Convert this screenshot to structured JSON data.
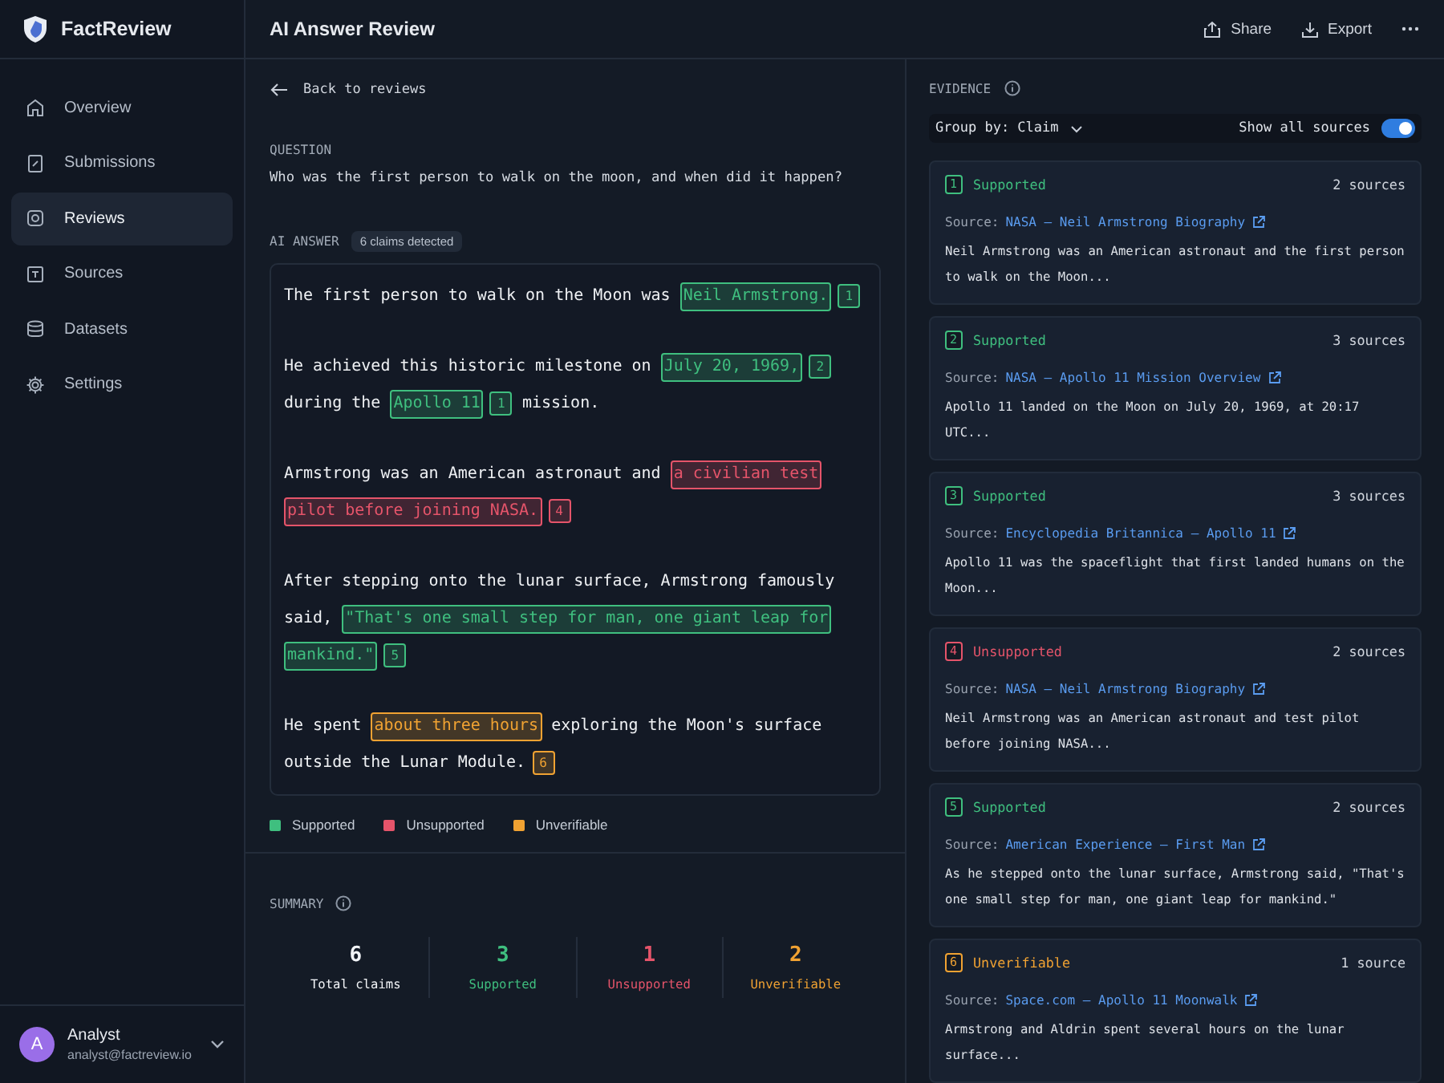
{
  "app": {
    "name": "FactReview"
  },
  "sidebar": {
    "items": [
      {
        "label": "Overview",
        "selected": false
      },
      {
        "label": "Submissions",
        "selected": false
      },
      {
        "label": "Reviews",
        "selected": true
      },
      {
        "label": "Sources",
        "selected": false
      },
      {
        "label": "Datasets",
        "selected": false
      },
      {
        "label": "Settings",
        "selected": false
      }
    ],
    "user": {
      "initial": "A",
      "name": "Analyst",
      "email": "analyst@factreview.io"
    }
  },
  "header": {
    "title": "AI Answer Review",
    "actions": [
      {
        "label": "Share"
      },
      {
        "label": "Export"
      }
    ]
  },
  "back_link": "Back to reviews",
  "question": {
    "label": "QUESTION",
    "text": "Who was the first person to walk on the moon, and when did it happen?"
  },
  "answer": {
    "label": "AI ANSWER",
    "badge": "6 claims detected",
    "paragraphs": [
      {
        "lines": [
          {
            "segments": [
              {
                "kind": "text",
                "text": "The first person to walk on the Moon was "
              },
              {
                "kind": "claim",
                "text": "Neil Armstrong.",
                "color": "#3fbf7f",
                "num": "1"
              }
            ]
          }
        ]
      },
      {
        "lines": [
          {
            "segments": [
              {
                "kind": "text",
                "text": "He achieved this historic milestone on "
              },
              {
                "kind": "claim",
                "text": "July 20, 1969,",
                "color": "#3fbf7f",
                "num": "2"
              }
            ]
          },
          {
            "segments": [
              {
                "kind": "text",
                "text": "during the "
              },
              {
                "kind": "claim",
                "text": "Apollo 11",
                "color": "#3fbf7f",
                "num": "1"
              },
              {
                "kind": "text",
                "text": " mission."
              }
            ]
          }
        ]
      },
      {
        "lines": [
          {
            "segments": [
              {
                "kind": "text",
                "text": "Armstrong was an American astronaut and "
              },
              {
                "kind": "claim",
                "text": "a civilian test",
                "color": "#e5546a"
              }
            ]
          },
          {
            "segments": [
              {
                "kind": "claim",
                "text": "pilot before joining NASA.",
                "color": "#e5546a",
                "num": "4"
              }
            ]
          }
        ]
      },
      {
        "lines": [
          {
            "segments": [
              {
                "kind": "text",
                "text": "After stepping onto the lunar surface, Armstrong famously"
              }
            ]
          },
          {
            "segments": [
              {
                "kind": "text",
                "text": "said, "
              },
              {
                "kind": "claim",
                "text": "\"That's one small step for man, one giant leap for",
                "color": "#3fbf7f"
              }
            ]
          },
          {
            "segments": [
              {
                "kind": "claim",
                "text": "mankind.\"",
                "color": "#3fbf7f",
                "num": "5"
              }
            ]
          }
        ]
      },
      {
        "lines": [
          {
            "segments": [
              {
                "kind": "text",
                "text": "He spent "
              },
              {
                "kind": "claim",
                "text": "about three hours",
                "color": "#f0a232"
              },
              {
                "kind": "text",
                "text": " exploring the Moon's surface"
              }
            ]
          },
          {
            "segments": [
              {
                "kind": "text",
                "text": "outside the Lunar Module."
              },
              {
                "kind": "badge",
                "color": "#f0a232",
                "num": "6"
              }
            ]
          }
        ]
      }
    ]
  },
  "legend": [
    {
      "label": "Supported",
      "color": "#3fbf7f"
    },
    {
      "label": "Unsupported",
      "color": "#e5546a"
    },
    {
      "label": "Unverifiable",
      "color": "#f0a232"
    }
  ],
  "summary": {
    "label": "SUMMARY",
    "stats": [
      {
        "value": "6",
        "label": "Total claims",
        "color": "#f2f4f7"
      },
      {
        "value": "3",
        "label": "Supported",
        "color": "#3fbf7f"
      },
      {
        "value": "1",
        "label": "Unsupported",
        "color": "#e5546a"
      },
      {
        "value": "2",
        "label": "Unverifiable",
        "color": "#f0a232"
      }
    ]
  },
  "evidence": {
    "label": "EVIDENCE",
    "group_by": "Group by: Claim",
    "show_all_label": "Show all sources",
    "show_all_on": true,
    "cards": [
      {
        "num": "1",
        "color": "#3fbf7f",
        "status_label": "Supported",
        "count": "2 sources",
        "source_prefix": "Source:",
        "source": "NASA – Neil Armstrong Biography",
        "excerpt": "Neil Armstrong was an American astronaut and the first person to walk on the Moon..."
      },
      {
        "num": "2",
        "color": "#3fbf7f",
        "status_label": "Supported",
        "count": "3 sources",
        "source_prefix": "Source:",
        "source": "NASA – Apollo 11 Mission Overview",
        "excerpt": "Apollo 11 landed on the Moon on July 20, 1969, at 20:17 UTC..."
      },
      {
        "num": "3",
        "color": "#3fbf7f",
        "status_label": "Supported",
        "count": "3 sources",
        "source_prefix": "Source:",
        "source": "Encyclopedia Britannica – Apollo 11",
        "excerpt": "Apollo 11 was the spaceflight that first landed humans on the Moon..."
      },
      {
        "num": "4",
        "color": "#e5546a",
        "status_label": "Unsupported",
        "count": "2 sources",
        "source_prefix": "Source:",
        "source": "NASA – Neil Armstrong Biography",
        "excerpt": "Neil Armstrong was an American astronaut and test pilot before joining NASA..."
      },
      {
        "num": "5",
        "color": "#3fbf7f",
        "status_label": "Supported",
        "count": "2 sources",
        "source_prefix": "Source:",
        "source": "American Experience – First Man",
        "excerpt": "As he stepped onto the lunar surface, Armstrong said, \"That's one small step for man, one giant leap for mankind.\""
      },
      {
        "num": "6",
        "color": "#f0a232",
        "status_label": "Unverifiable",
        "count": "1 source",
        "source_prefix": "Source:",
        "source": "Space.com – Apollo 11 Moonwalk",
        "excerpt": "Armstrong and Aldrin spent several hours on the lunar surface..."
      }
    ]
  }
}
